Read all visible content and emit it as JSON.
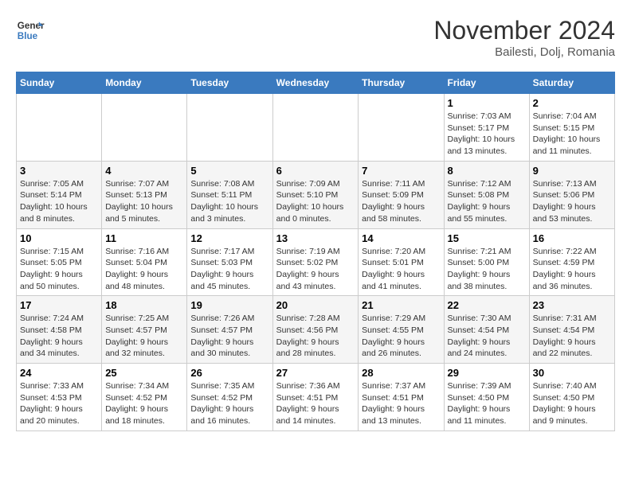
{
  "header": {
    "logo_line1": "General",
    "logo_line2": "Blue",
    "month": "November 2024",
    "location": "Bailesti, Dolj, Romania"
  },
  "weekdays": [
    "Sunday",
    "Monday",
    "Tuesday",
    "Wednesday",
    "Thursday",
    "Friday",
    "Saturday"
  ],
  "weeks": [
    [
      {
        "day": "",
        "info": ""
      },
      {
        "day": "",
        "info": ""
      },
      {
        "day": "",
        "info": ""
      },
      {
        "day": "",
        "info": ""
      },
      {
        "day": "",
        "info": ""
      },
      {
        "day": "1",
        "info": "Sunrise: 7:03 AM\nSunset: 5:17 PM\nDaylight: 10 hours\nand 13 minutes."
      },
      {
        "day": "2",
        "info": "Sunrise: 7:04 AM\nSunset: 5:15 PM\nDaylight: 10 hours\nand 11 minutes."
      }
    ],
    [
      {
        "day": "3",
        "info": "Sunrise: 7:05 AM\nSunset: 5:14 PM\nDaylight: 10 hours\nand 8 minutes."
      },
      {
        "day": "4",
        "info": "Sunrise: 7:07 AM\nSunset: 5:13 PM\nDaylight: 10 hours\nand 5 minutes."
      },
      {
        "day": "5",
        "info": "Sunrise: 7:08 AM\nSunset: 5:11 PM\nDaylight: 10 hours\nand 3 minutes."
      },
      {
        "day": "6",
        "info": "Sunrise: 7:09 AM\nSunset: 5:10 PM\nDaylight: 10 hours\nand 0 minutes."
      },
      {
        "day": "7",
        "info": "Sunrise: 7:11 AM\nSunset: 5:09 PM\nDaylight: 9 hours\nand 58 minutes."
      },
      {
        "day": "8",
        "info": "Sunrise: 7:12 AM\nSunset: 5:08 PM\nDaylight: 9 hours\nand 55 minutes."
      },
      {
        "day": "9",
        "info": "Sunrise: 7:13 AM\nSunset: 5:06 PM\nDaylight: 9 hours\nand 53 minutes."
      }
    ],
    [
      {
        "day": "10",
        "info": "Sunrise: 7:15 AM\nSunset: 5:05 PM\nDaylight: 9 hours\nand 50 minutes."
      },
      {
        "day": "11",
        "info": "Sunrise: 7:16 AM\nSunset: 5:04 PM\nDaylight: 9 hours\nand 48 minutes."
      },
      {
        "day": "12",
        "info": "Sunrise: 7:17 AM\nSunset: 5:03 PM\nDaylight: 9 hours\nand 45 minutes."
      },
      {
        "day": "13",
        "info": "Sunrise: 7:19 AM\nSunset: 5:02 PM\nDaylight: 9 hours\nand 43 minutes."
      },
      {
        "day": "14",
        "info": "Sunrise: 7:20 AM\nSunset: 5:01 PM\nDaylight: 9 hours\nand 41 minutes."
      },
      {
        "day": "15",
        "info": "Sunrise: 7:21 AM\nSunset: 5:00 PM\nDaylight: 9 hours\nand 38 minutes."
      },
      {
        "day": "16",
        "info": "Sunrise: 7:22 AM\nSunset: 4:59 PM\nDaylight: 9 hours\nand 36 minutes."
      }
    ],
    [
      {
        "day": "17",
        "info": "Sunrise: 7:24 AM\nSunset: 4:58 PM\nDaylight: 9 hours\nand 34 minutes."
      },
      {
        "day": "18",
        "info": "Sunrise: 7:25 AM\nSunset: 4:57 PM\nDaylight: 9 hours\nand 32 minutes."
      },
      {
        "day": "19",
        "info": "Sunrise: 7:26 AM\nSunset: 4:57 PM\nDaylight: 9 hours\nand 30 minutes."
      },
      {
        "day": "20",
        "info": "Sunrise: 7:28 AM\nSunset: 4:56 PM\nDaylight: 9 hours\nand 28 minutes."
      },
      {
        "day": "21",
        "info": "Sunrise: 7:29 AM\nSunset: 4:55 PM\nDaylight: 9 hours\nand 26 minutes."
      },
      {
        "day": "22",
        "info": "Sunrise: 7:30 AM\nSunset: 4:54 PM\nDaylight: 9 hours\nand 24 minutes."
      },
      {
        "day": "23",
        "info": "Sunrise: 7:31 AM\nSunset: 4:54 PM\nDaylight: 9 hours\nand 22 minutes."
      }
    ],
    [
      {
        "day": "24",
        "info": "Sunrise: 7:33 AM\nSunset: 4:53 PM\nDaylight: 9 hours\nand 20 minutes."
      },
      {
        "day": "25",
        "info": "Sunrise: 7:34 AM\nSunset: 4:52 PM\nDaylight: 9 hours\nand 18 minutes."
      },
      {
        "day": "26",
        "info": "Sunrise: 7:35 AM\nSunset: 4:52 PM\nDaylight: 9 hours\nand 16 minutes."
      },
      {
        "day": "27",
        "info": "Sunrise: 7:36 AM\nSunset: 4:51 PM\nDaylight: 9 hours\nand 14 minutes."
      },
      {
        "day": "28",
        "info": "Sunrise: 7:37 AM\nSunset: 4:51 PM\nDaylight: 9 hours\nand 13 minutes."
      },
      {
        "day": "29",
        "info": "Sunrise: 7:39 AM\nSunset: 4:50 PM\nDaylight: 9 hours\nand 11 minutes."
      },
      {
        "day": "30",
        "info": "Sunrise: 7:40 AM\nSunset: 4:50 PM\nDaylight: 9 hours\nand 9 minutes."
      }
    ]
  ]
}
